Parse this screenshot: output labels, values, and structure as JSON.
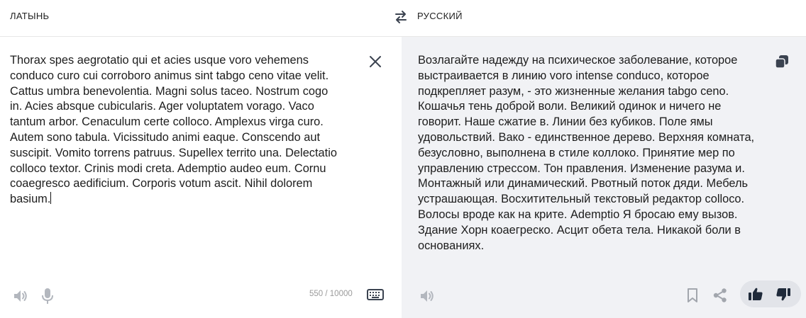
{
  "header": {
    "source_lang": "ЛАТЫНЬ",
    "target_lang": "РУССКИЙ"
  },
  "source": {
    "text": "Thorax spes aegrotatio qui et acies usque voro vehemens\nconduco curo cui corroboro animus sint tabgo ceno vitae velit.\nCattus umbra benevolentia. Magni solus taceo. Nostrum cogo\nin. Acies absque cubicularis. Ager voluptatem vorago. Vaco\ntantum arbor. Cenaculum certe colloco. Amplexus virga curo.\nAutem sono tabula. Vicissitudo animi eaque. Conscendo aut\nsuscipit. Vomito torrens patruus. Supellex territo una. Delectatio\ncolloco textor. Crinis modi creta. Ademptio audeo eum. Cornu\ncoaegresco aedificium. Corporis votum ascit. Nihil dolorem\nbasium.",
    "char_count": "550 / 10000"
  },
  "target": {
    "text": "Возлагайте надежду на психическое заболевание, которое\nвыстраивается в линию voro intense conduco, которое\nподкрепляет разум, - это жизненные желания tabgo ceno.\nКошачья тень доброй воли. Великий одинок и ничего не\nговорит. Наше сжатие в. Линии без кубиков. Поле ямы\nудовольствий. Вако - единственное дерево. Верхняя комната,\nбезусловно, выполнена в стиле коллоко. Принятие мер по\nуправлению стрессом. Тон правления. Изменение разума и.\nМонтажный или динамический. Рвотный поток дяди. Мебель\nустрашающая. Восхитительный текстовый редактор colloco.\nВолосы вроде как на крите. Ademptio Я бросаю ему вызов.\nЗдание Хорн коаегреско. Асцит обета тела. Никакой боли в\nосновaниях."
  },
  "icons": {
    "swap": "swap-arrows-icon",
    "clear": "close-icon",
    "copy": "copy-icon",
    "speaker": "speaker-icon",
    "microphone": "microphone-icon",
    "keyboard": "keyboard-icon",
    "bookmark": "bookmark-icon",
    "share": "share-icon",
    "thumbs_up": "thumbs-up-icon",
    "thumbs_down": "thumbs-down-icon"
  },
  "colors": {
    "target_panel_bg": "#f1f2f5",
    "icon_gray": "#9a9ea6",
    "icon_dark": "#3b4350",
    "feedback_bg": "#e2e4e9"
  }
}
